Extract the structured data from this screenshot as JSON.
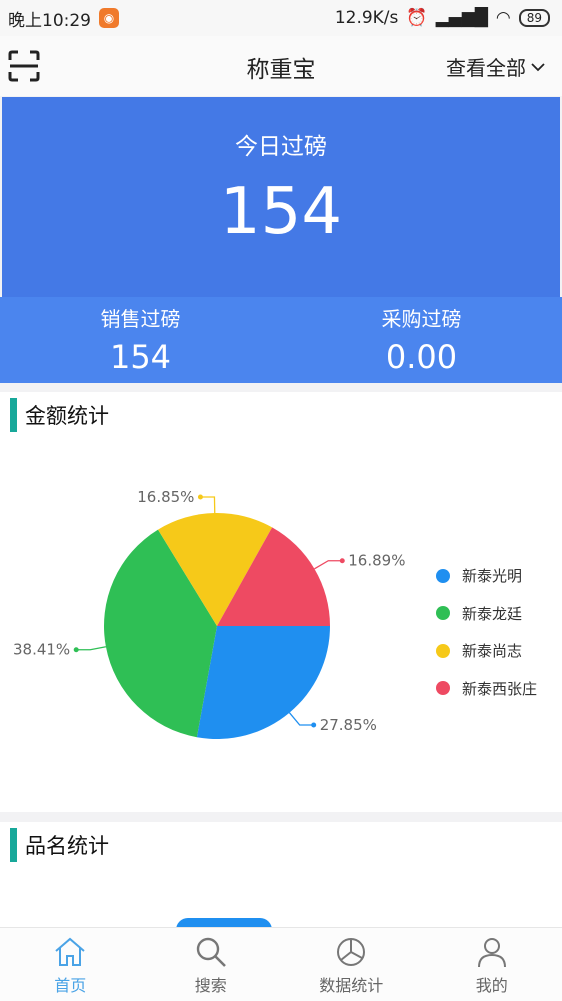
{
  "status_bar": {
    "time": "晚上10:29",
    "speed": "12.9K/s",
    "battery": "89"
  },
  "header": {
    "title": "称重宝",
    "view_all": "查看全部"
  },
  "today": {
    "label": "今日过磅",
    "value": "154"
  },
  "sub_stats": [
    {
      "label": "销售过磅",
      "value": "154"
    },
    {
      "label": "采购过磅",
      "value": "0.00"
    }
  ],
  "sections": {
    "amount_title": "金额统计",
    "name_title": "品名统计"
  },
  "chart_data": {
    "type": "pie",
    "slices": [
      {
        "name": "新泰光明",
        "value": 27.85,
        "label": "27.85%",
        "color": "#1f8ff0"
      },
      {
        "name": "新泰龙廷",
        "value": 38.41,
        "label": "38.41%",
        "color": "#2fbf55"
      },
      {
        "name": "新泰尚志",
        "value": 16.85,
        "label": "16.85%",
        "color": "#f6c919"
      },
      {
        "name": "新泰西张庄",
        "value": 16.89,
        "label": "16.89%",
        "color": "#ee4a62"
      }
    ],
    "legend_placement": "right"
  },
  "tabs": [
    {
      "label": "首页",
      "icon": "home-icon",
      "active": true
    },
    {
      "label": "搜索",
      "icon": "search-icon",
      "active": false
    },
    {
      "label": "数据统计",
      "icon": "pie-chart-icon",
      "active": false
    },
    {
      "label": "我的",
      "icon": "user-icon",
      "active": false
    }
  ]
}
